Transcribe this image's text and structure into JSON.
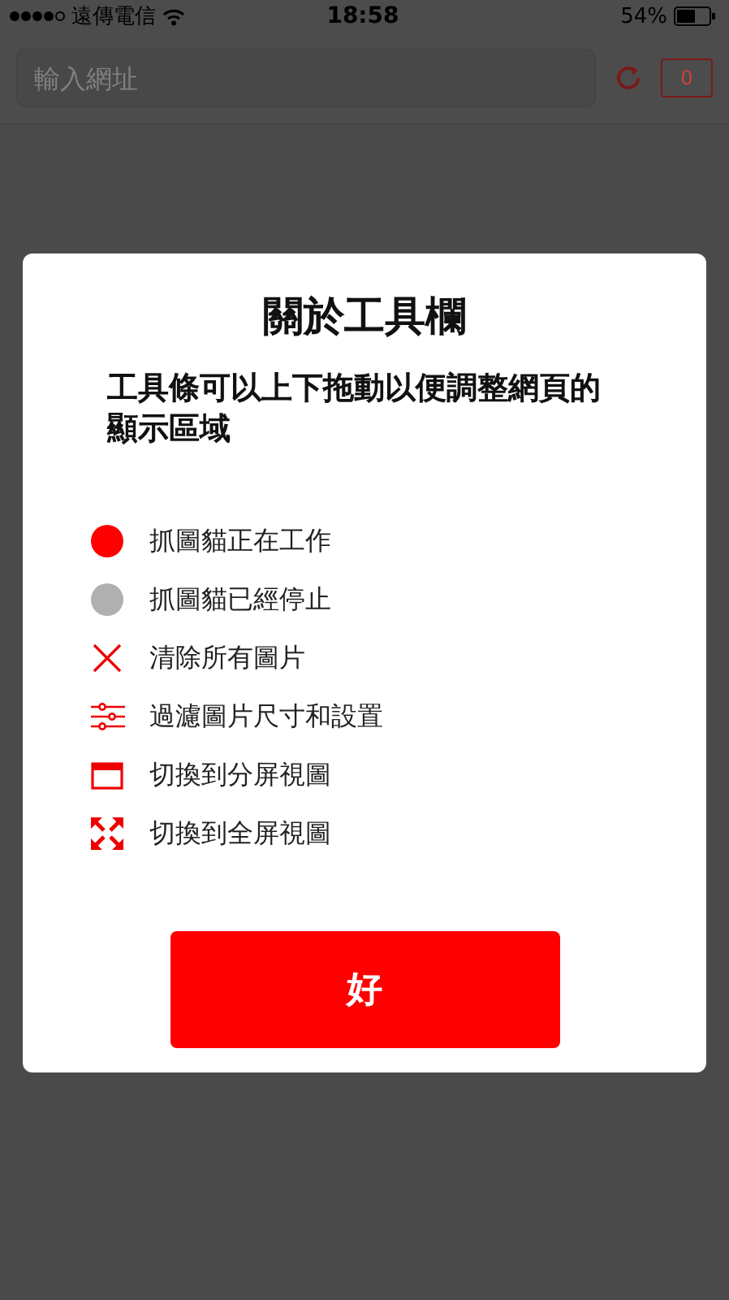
{
  "status_bar": {
    "carrier": "遠傳電信",
    "time": "18:58",
    "battery": "54%"
  },
  "address_bar": {
    "placeholder": "輸入網址",
    "folder_count": "0"
  },
  "dialog": {
    "title": "關於工具欄",
    "message": "工具條可以上下拖動以便調整網頁的顯示區域",
    "items": [
      {
        "kind": "dot",
        "color": "#ff0000",
        "label": "抓圖貓正在工作"
      },
      {
        "kind": "dot",
        "color": "#b0b0b0",
        "label": "抓圖貓已經停止"
      },
      {
        "kind": "clear",
        "label": "清除所有圖片"
      },
      {
        "kind": "filter",
        "label": "過濾圖片尺寸和設置"
      },
      {
        "kind": "split",
        "label": "切換到分屏視圖"
      },
      {
        "kind": "fullscreen",
        "label": "切換到全屏視圖"
      }
    ],
    "button": "好"
  }
}
